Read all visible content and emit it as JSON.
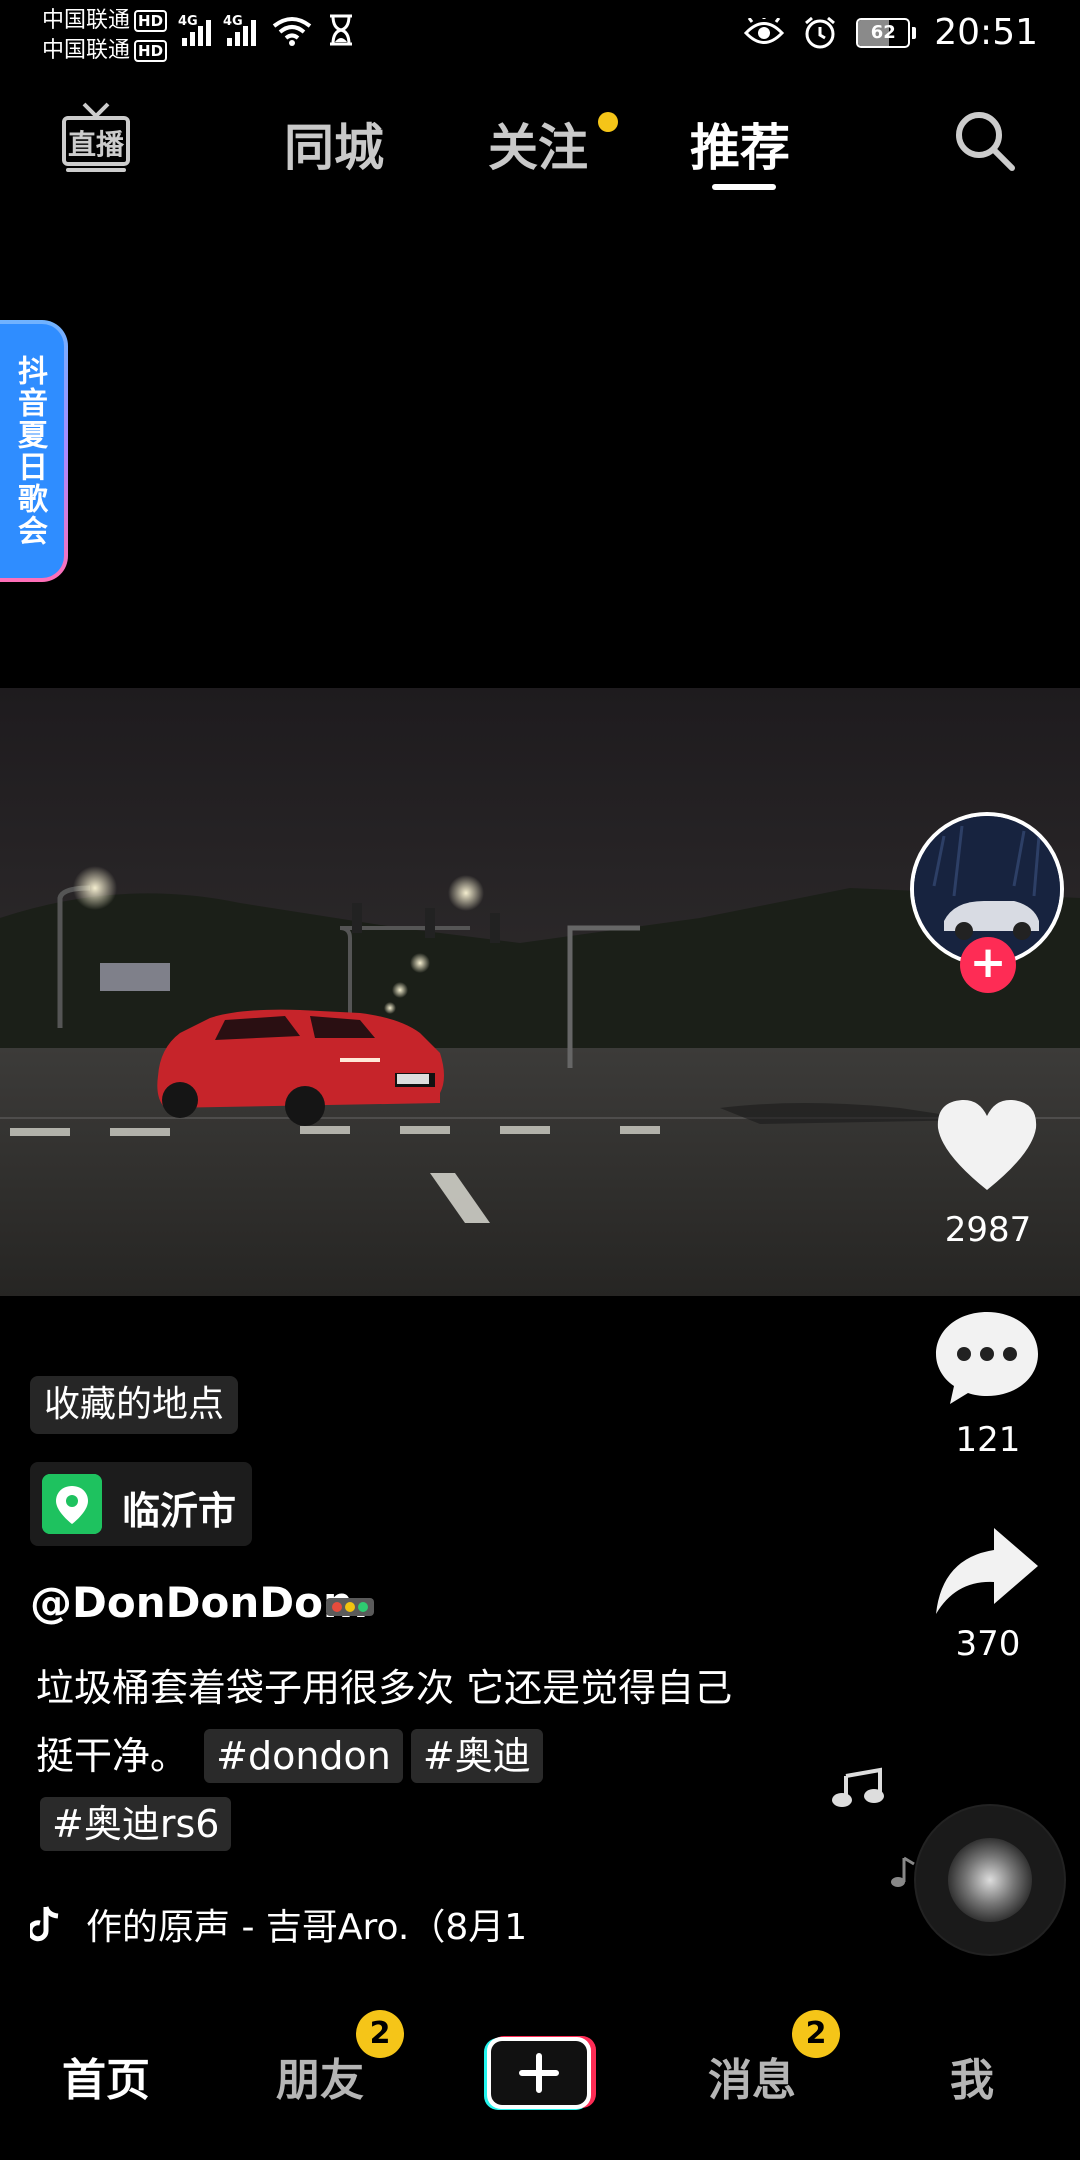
{
  "status_bar": {
    "carrier1": "中国联通",
    "carrier2": "中国联通",
    "hd": "HD",
    "network": "4G",
    "battery": "62",
    "battery_level": 0.62,
    "time": "20:51"
  },
  "top_nav": {
    "live_icon": "live-icon",
    "tabs": [
      {
        "label": "同城",
        "active": false
      },
      {
        "label": "关注",
        "active": false,
        "has_dot": true
      },
      {
        "label": "推荐",
        "active": true
      }
    ],
    "search_icon": "search-icon"
  },
  "side_banner": {
    "label": "抖音夏日歌会"
  },
  "rail": {
    "likes": "2987",
    "comments": "121",
    "shares": "370"
  },
  "post": {
    "tag_label": "收藏的地点",
    "location": "临沂市",
    "username": "@DonDonDon.",
    "caption": "垃圾桶套着袋子用很多次 它还是觉得自己挺干净。",
    "hashtags": [
      "#dondon",
      "#奥迪",
      "#奥迪rs6"
    ],
    "music": "作的原声 - 吉哥Aro.（8月1"
  },
  "bottom_nav": {
    "home": "首页",
    "friends": "朋友",
    "friends_badge": "2",
    "messages": "消息",
    "messages_badge": "2",
    "me": "我"
  },
  "colors": {
    "accent_red": "#fe2c55",
    "badge_yellow": "#f5c518",
    "location_green": "#1ec25f"
  }
}
